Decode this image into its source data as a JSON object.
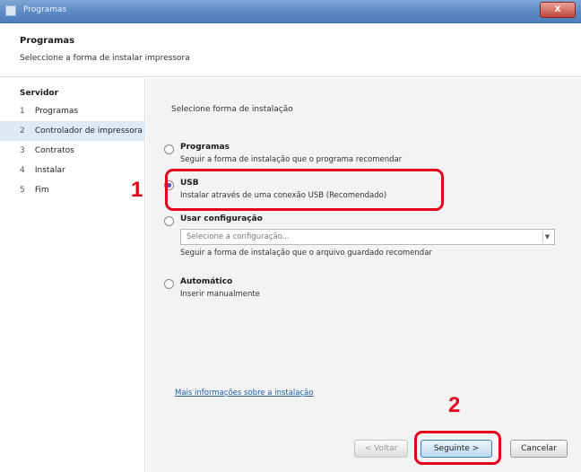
{
  "window": {
    "title": "Programas",
    "close_label": "X"
  },
  "header": {
    "title": "Programas",
    "description": "Seleccione a forma de instalar impressora"
  },
  "sidebar": {
    "heading": "Servidor",
    "items": [
      {
        "num": "1",
        "label": "Programas"
      },
      {
        "num": "2",
        "label": "Controlador de impressora"
      },
      {
        "num": "3",
        "label": "Contratos"
      },
      {
        "num": "4",
        "label": "Instalar"
      },
      {
        "num": "5",
        "label": "Fim"
      }
    ],
    "active_index": 1
  },
  "main": {
    "prompt": "Selecione forma de instalação",
    "options": {
      "software": {
        "label": "Programas",
        "desc": "Seguir a forma de instalação que o programa recomendar"
      },
      "usb": {
        "label": "USB",
        "desc": "Instalar através de uma conexão USB (Recomendado)"
      },
      "saved": {
        "label": "Usar configuração",
        "select_placeholder": "Selecione a configuração...",
        "desc": "Seguir a forma de instalação que o arquivo guardado recomendar"
      },
      "auto": {
        "label": "Automático",
        "desc": "Inserir manualmente"
      }
    },
    "help_link": "Mais informações sobre a instalação",
    "buttons": {
      "back": "< Voltar",
      "next": "Seguinte >",
      "cancel": "Cancelar"
    }
  },
  "callouts": {
    "one": "1",
    "two": "2"
  },
  "colors": {
    "callout": "#e3001b",
    "titlebar": "#5f8cc6",
    "selection": "#dfe9f6"
  }
}
